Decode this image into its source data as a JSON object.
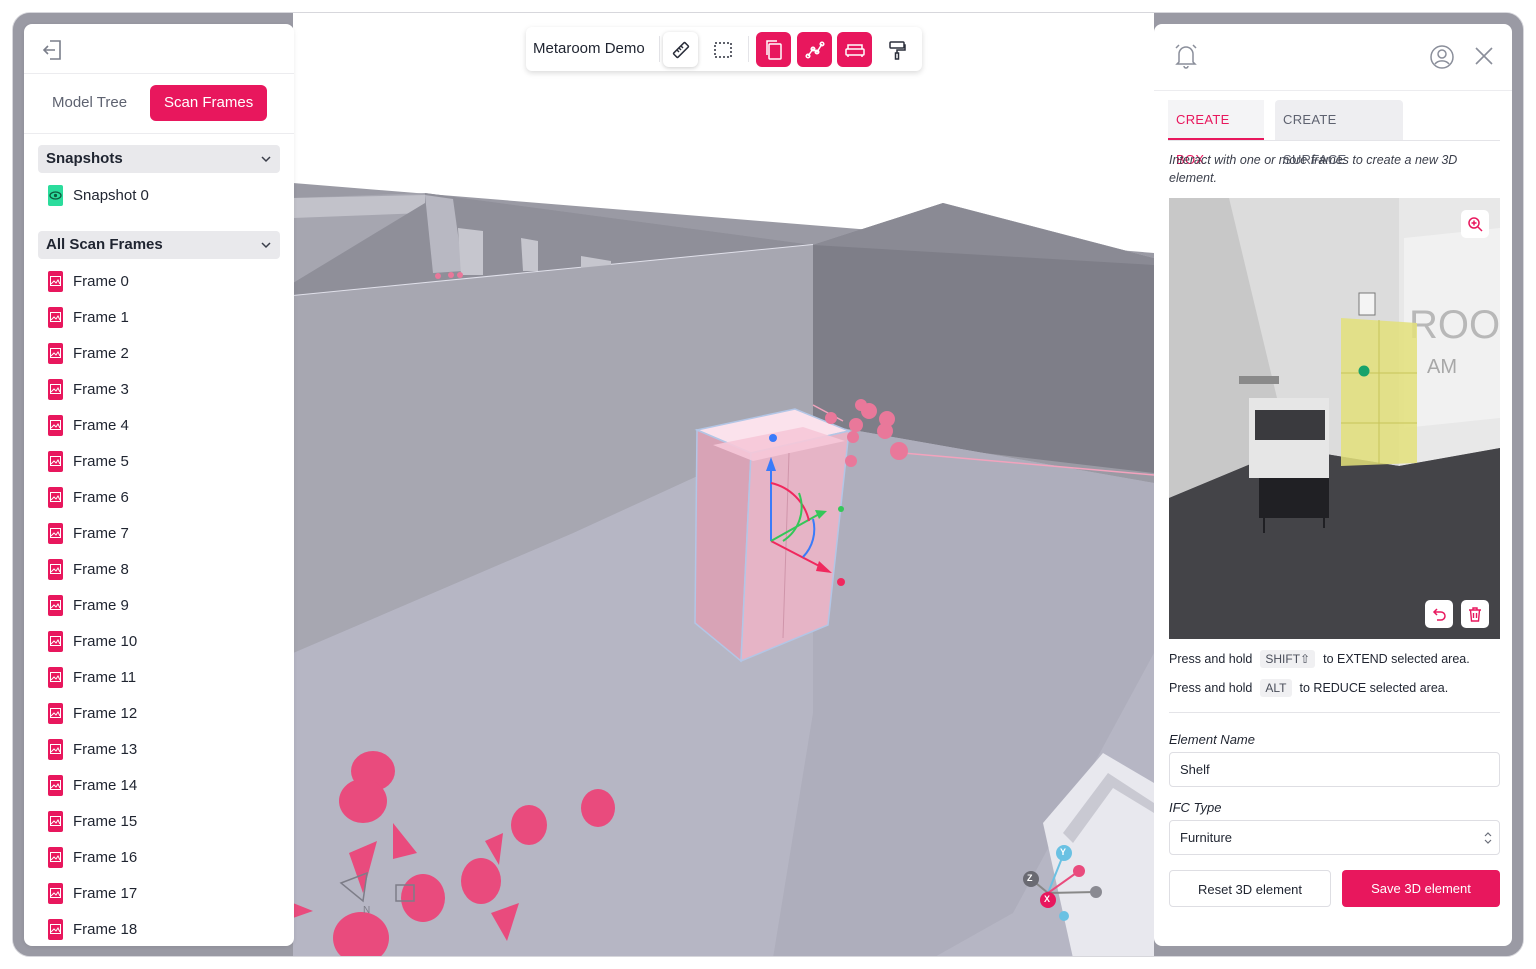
{
  "toolbar": {
    "title": "Metaroom Demo",
    "tools": [
      "ruler-icon",
      "select-area-icon",
      "copy-frames-icon",
      "polyline-icon",
      "sofa-icon",
      "paint-roller-icon"
    ]
  },
  "left_panel": {
    "tabs": {
      "model_tree": "Model Tree",
      "scan_frames": "Scan Frames"
    },
    "snapshots": {
      "title": "Snapshots",
      "items": [
        "Snapshot 0"
      ]
    },
    "scan_frames": {
      "title": "All Scan Frames",
      "items": [
        "Frame 0",
        "Frame 1",
        "Frame 2",
        "Frame 3",
        "Frame 4",
        "Frame 5",
        "Frame 6",
        "Frame 7",
        "Frame 8",
        "Frame 9",
        "Frame 10",
        "Frame 11",
        "Frame 12",
        "Frame 13",
        "Frame 14",
        "Frame 15",
        "Frame 16",
        "Frame 17",
        "Frame 18"
      ]
    }
  },
  "right_panel": {
    "tabs": {
      "create_box": "CREATE BOX",
      "create_surface": "CREATE SURFACE"
    },
    "hint": "Interact with one or more frames to create a new 3D element.",
    "shortcuts": {
      "extend": {
        "prefix": "Press and hold",
        "key": "SHIFT⇧",
        "suffix": "to EXTEND selected area."
      },
      "reduce": {
        "prefix": "Press and hold",
        "key": "ALT",
        "suffix": "to REDUCE selected area."
      }
    },
    "element_name": {
      "label": "Element Name",
      "value": "Shelf"
    },
    "ifc_type": {
      "label": "IFC Type",
      "value": "Furniture"
    },
    "buttons": {
      "reset": "Reset 3D element",
      "save": "Save 3D element"
    }
  },
  "gizmo_axes": {
    "x": "X",
    "y": "Y",
    "z": "Z"
  },
  "colors": {
    "accent": "#e8175d",
    "eye": "#2bdc9c",
    "selection": "#f2a3bd"
  }
}
